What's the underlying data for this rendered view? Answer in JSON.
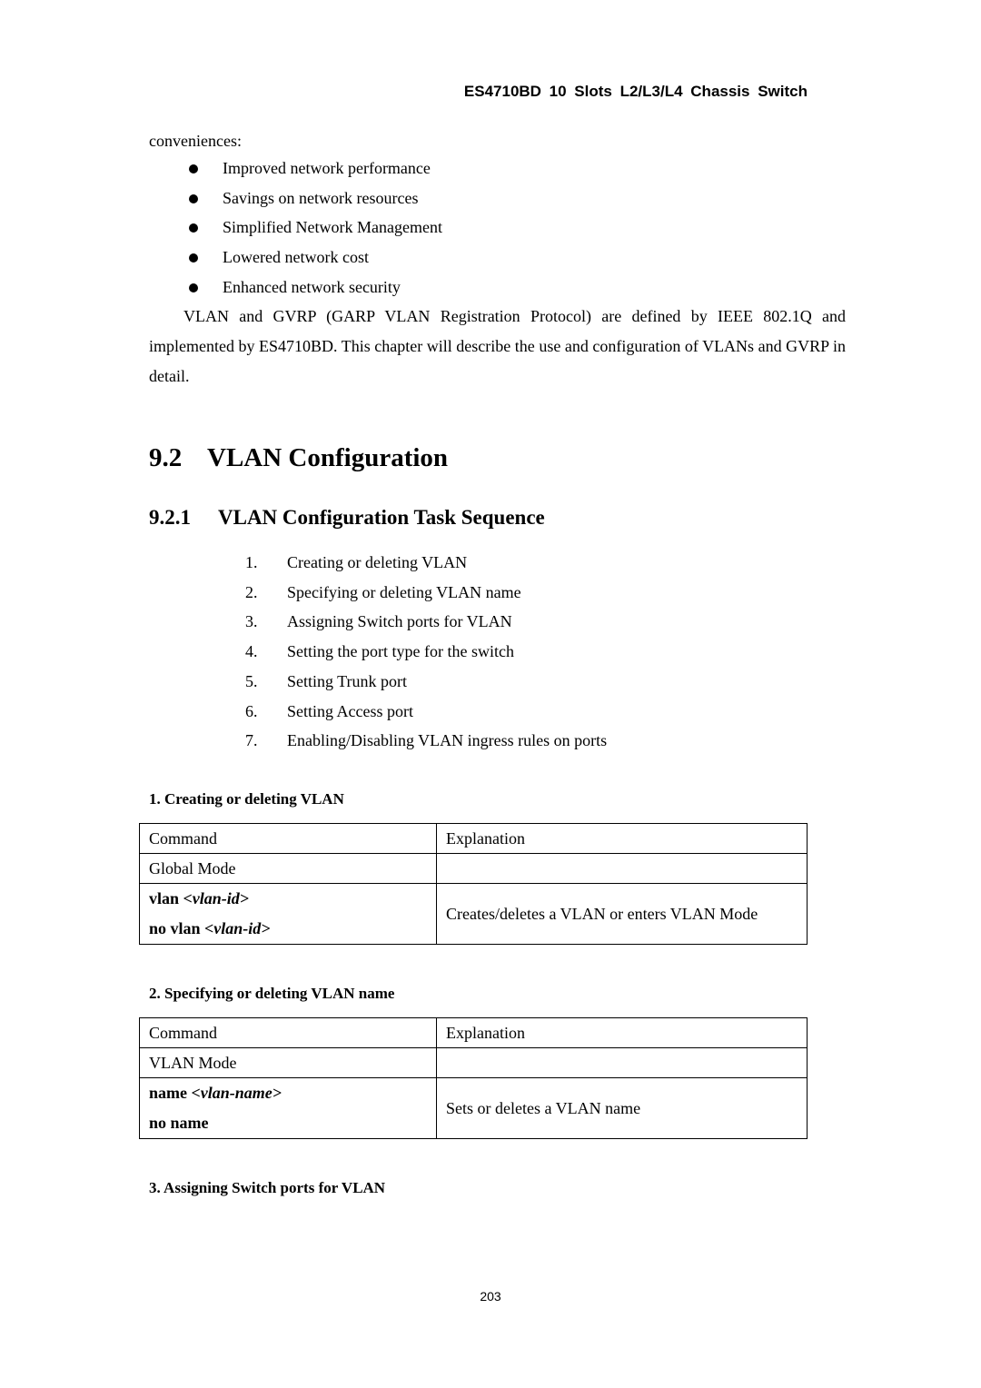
{
  "header": {
    "title": "ES4710BD 10 Slots L2/L3/L4 Chassis Switch"
  },
  "intro": {
    "text": "conveniences:"
  },
  "bullets": [
    "Improved network performance",
    "Savings on network resources",
    "Simplified Network Management",
    "Lowered network cost",
    "Enhanced network security"
  ],
  "paragraph": "VLAN and GVRP (GARP VLAN Registration Protocol) are defined by IEEE 802.1Q and implemented by ES4710BD. This chapter will describe the use and configuration of VLANs and GVRP in detail.",
  "section": {
    "number": "9.2",
    "title": "VLAN Configuration"
  },
  "subsection": {
    "number": "9.2.1",
    "title": "VLAN Configuration Task Sequence"
  },
  "tasks": [
    {
      "n": "1.",
      "text": "Creating or deleting VLAN"
    },
    {
      "n": "2.",
      "text": "Specifying or deleting VLAN name"
    },
    {
      "n": "3.",
      "text": "Assigning Switch ports for VLAN"
    },
    {
      "n": "4.",
      "text": "Setting the port type for the switch"
    },
    {
      "n": "5.",
      "text": "Setting Trunk port"
    },
    {
      "n": "6.",
      "text": "Setting Access port"
    },
    {
      "n": "7.",
      "text": "Enabling/Disabling VLAN ingress rules on ports"
    }
  ],
  "tables": [
    {
      "heading": "1. Creating or deleting VLAN",
      "col_command": "Command",
      "col_explanation": "Explanation",
      "mode": "Global Mode",
      "cmd1_keyword": "vlan ",
      "cmd1_arg": "<vlan-id>",
      "cmd2_keyword": "no vlan ",
      "cmd2_arg": "<vlan-id>",
      "explanation": "Creates/deletes a VLAN or enters VLAN Mode"
    },
    {
      "heading": "2. Specifying or deleting VLAN name",
      "col_command": "Command",
      "col_explanation": "Explanation",
      "mode": "VLAN Mode",
      "cmd1_keyword": "name ",
      "cmd1_arg": "<vlan-name>",
      "cmd2_keyword": "no name",
      "cmd2_arg": "",
      "explanation": "Sets or deletes a VLAN name"
    }
  ],
  "next_heading": "3. Assigning Switch ports for VLAN",
  "page_number": "203"
}
